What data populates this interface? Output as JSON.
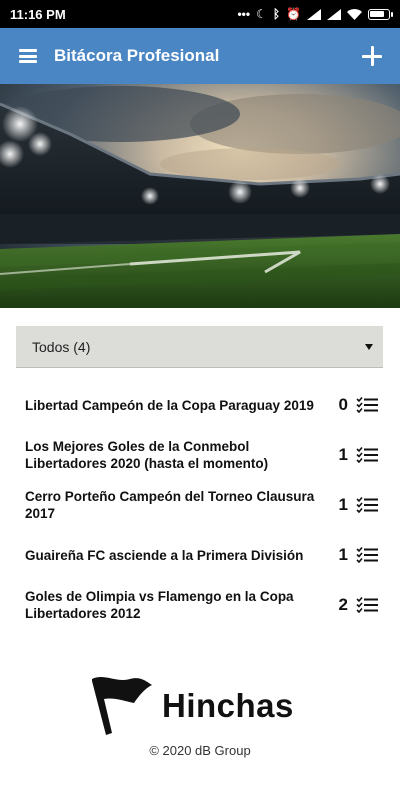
{
  "status_bar": {
    "time": "11:16 PM",
    "icons": [
      "more-icon",
      "moon-icon",
      "bluetooth-icon",
      "alarm-icon",
      "signal-icon",
      "signal-icon",
      "wifi-icon",
      "battery-icon"
    ],
    "battery_level": 0.85
  },
  "app_bar": {
    "title": "Bitácora Profesional",
    "menu_icon": "menu-icon",
    "add_icon": "plus-icon",
    "color": "#4a86c3"
  },
  "hero": {
    "image": "stadium-photo"
  },
  "filter": {
    "selected": "Todos (4)"
  },
  "items": [
    {
      "title": "Libertad Campeón de la Copa Paraguay 2019",
      "count": "0"
    },
    {
      "title": "Los Mejores Goles de la Conmebol Libertadores 2020 (hasta el momento)",
      "count": "1"
    },
    {
      "title": "Cerro Porteño Campeón del Torneo Clausura 2017",
      "count": "1"
    },
    {
      "title": "Guaireña FC asciende a la Primera División",
      "count": "1"
    },
    {
      "title": "Goles de Olimpia vs Flamengo en la Copa Libertadores 2012",
      "count": "2"
    }
  ],
  "footer": {
    "brand": "Hinchas",
    "logo_icon": "flag-icon",
    "copyright": "© 2020 dB Group"
  }
}
